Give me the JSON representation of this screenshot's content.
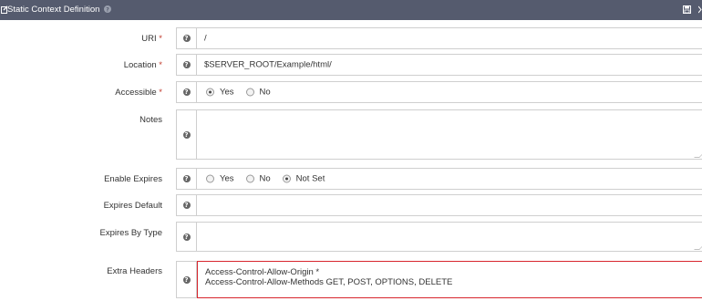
{
  "header": {
    "title": "Static Context Definition"
  },
  "fields": {
    "uri": {
      "label": "URI",
      "required": "*",
      "value": "/"
    },
    "location": {
      "label": "Location",
      "required": "*",
      "value": "$SERVER_ROOT/Example/html/"
    },
    "accessible": {
      "label": "Accessible",
      "required": "*",
      "options": [
        "Yes",
        "No"
      ],
      "selected": "Yes"
    },
    "notes": {
      "label": "Notes",
      "value": ""
    },
    "enable_expires": {
      "label": "Enable Expires",
      "options": [
        "Yes",
        "No",
        "Not Set"
      ],
      "selected": "Not Set"
    },
    "expires_default": {
      "label": "Expires Default",
      "value": ""
    },
    "expires_by_type": {
      "label": "Expires By Type",
      "value": ""
    },
    "extra_headers": {
      "label": "Extra Headers",
      "lines": [
        "Access-Control-Allow-Origin *",
        "Access-Control-Allow-Methods GET, POST, OPTIONS, DELETE"
      ]
    }
  },
  "colors": {
    "header_bg": "#555b6e",
    "required": "#c0392b",
    "highlight_border": "#d8262e"
  }
}
